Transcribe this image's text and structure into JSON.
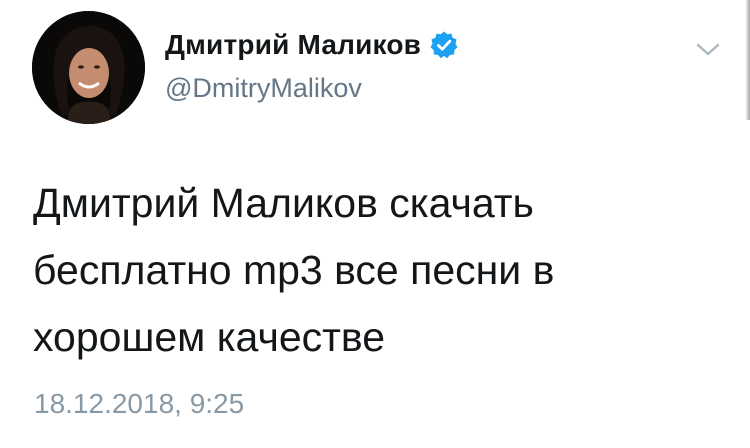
{
  "tweet": {
    "author": {
      "display_name": "Дмитрий Маликов",
      "handle": "@DmitryMalikov",
      "verified": true,
      "avatar_icon": "user-photo-avatar"
    },
    "text": "Дмитрий Маликов скачать\nбесплатно mp3 все песни в\nхорошем качестве",
    "timestamp": "18.12.2018, 9:25",
    "menu_icon": "chevron-down-icon"
  },
  "colors": {
    "name": "#14171a",
    "handle": "#657786",
    "timestamp": "#8899a6",
    "verified_badge": "#1da1f2",
    "background": "#ffffff"
  }
}
